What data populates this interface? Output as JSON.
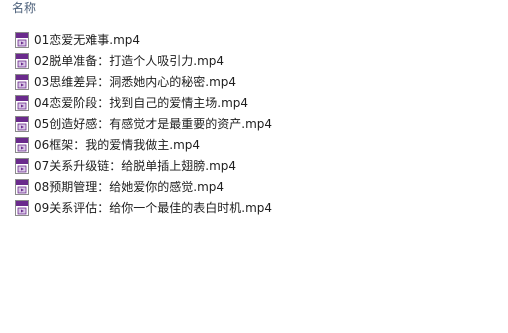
{
  "header": {
    "column_label": "名称"
  },
  "files": [
    {
      "name": "01恋爱无难事.mp4",
      "icon": "mp4-file-icon"
    },
    {
      "name": "02脱单准备：打造个人吸引力.mp4",
      "icon": "mp4-file-icon"
    },
    {
      "name": "03思维差异：洞悉她内心的秘密.mp4",
      "icon": "mp4-file-icon"
    },
    {
      "name": "04恋爱阶段：找到自己的爱情主场.mp4",
      "icon": "mp4-file-icon"
    },
    {
      "name": "05创造好感：有感觉才是最重要的资产.mp4",
      "icon": "mp4-file-icon"
    },
    {
      "name": "06框架：我的爱情我做主.mp4",
      "icon": "mp4-file-icon"
    },
    {
      "name": "07关系升级链：给脱单插上翅膀.mp4",
      "icon": "mp4-file-icon"
    },
    {
      "name": "08预期管理：给她爱你的感觉.mp4",
      "icon": "mp4-file-icon"
    },
    {
      "name": "09关系评估：给你一个最佳的表白时机.mp4",
      "icon": "mp4-file-icon"
    }
  ],
  "colors": {
    "header_text": "#4c607a",
    "file_text": "#1e1e1e",
    "icon_accent": "#6a2a8c"
  }
}
